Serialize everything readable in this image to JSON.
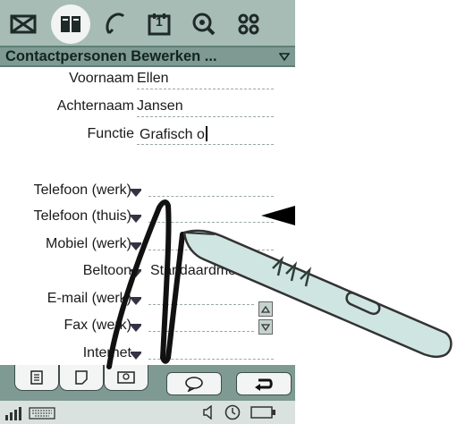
{
  "app_bar": {
    "icons": [
      "envelope-icon",
      "contacts-book-icon",
      "phone-icon",
      "calendar-icon",
      "search-globe-icon",
      "apps-grid-icon"
    ],
    "calendar_day": "1"
  },
  "title_bar": {
    "title": "Contactpersonen Bewerken ..."
  },
  "form": {
    "first_name": {
      "label": "Voornaam",
      "value": "Ellen"
    },
    "last_name": {
      "label": "Achternaam",
      "value": "Jansen"
    },
    "function": {
      "label": "Functie",
      "value": "Grafisch o"
    },
    "phone_work": {
      "label": "Telefoon (werk)"
    },
    "phone_home": {
      "label": "Telefoon (thuis)"
    },
    "mobile_work": {
      "label": "Mobiel (werk)"
    },
    "ringtone": {
      "label": "Beltoon",
      "value": "Standaardmel"
    },
    "email_work": {
      "label": "E-mail (werk)"
    },
    "fax_work": {
      "label": "Fax (werk)"
    },
    "internet": {
      "label": "Internet"
    }
  },
  "colors": {
    "bar_dark": "#7e9a92",
    "bar_light": "#a8bcb6",
    "pen_body": "#cfe5e1"
  }
}
